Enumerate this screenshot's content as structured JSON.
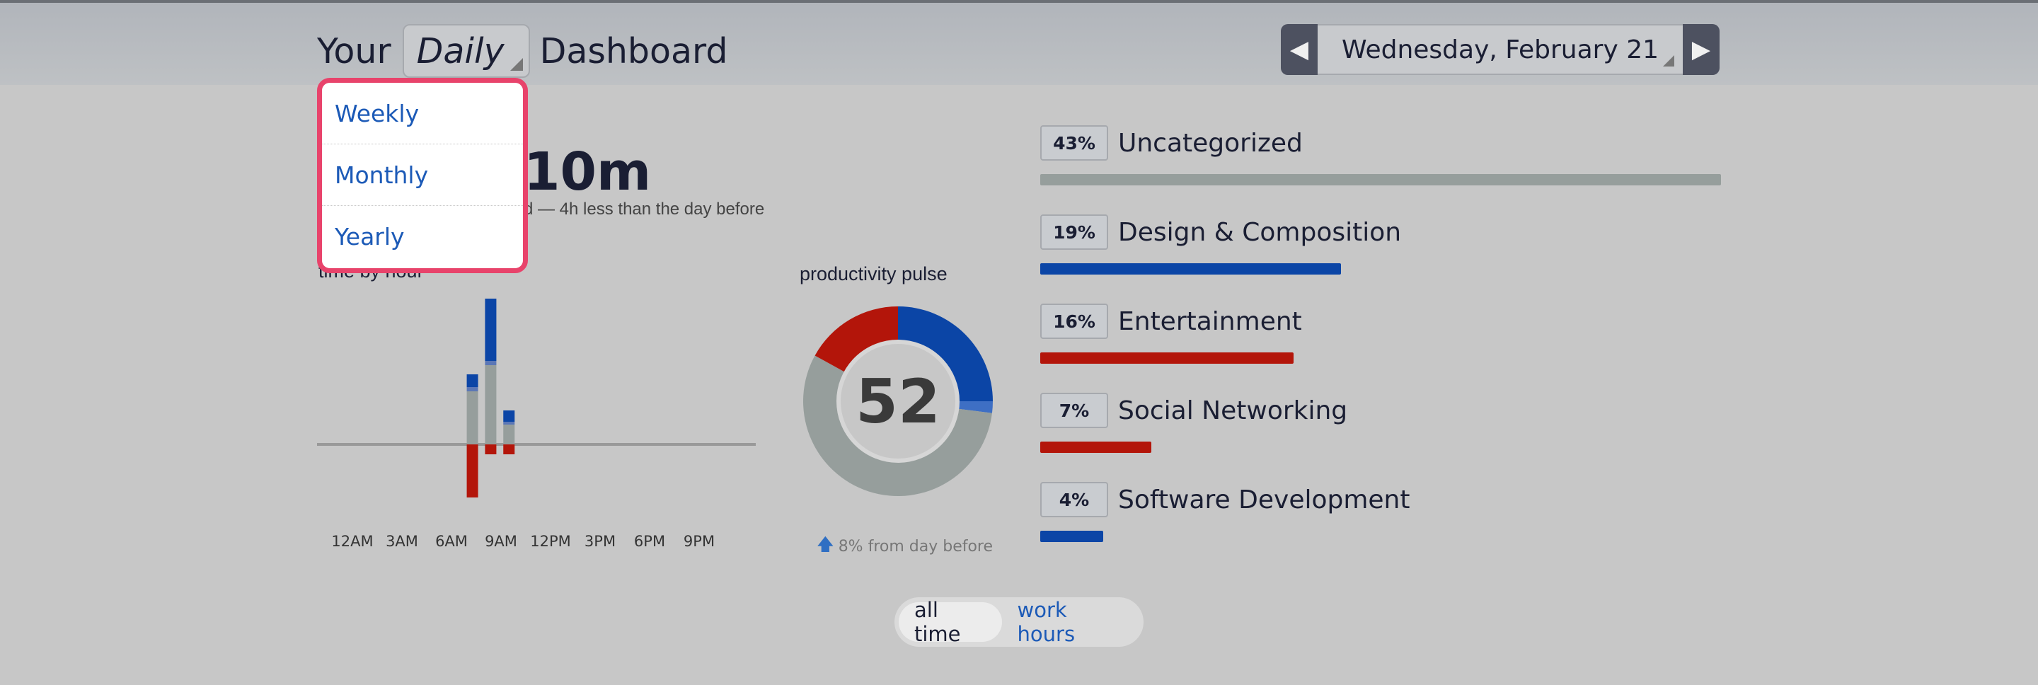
{
  "header": {
    "title_prefix": "Your",
    "range_selected": "Daily",
    "title_suffix": "Dashboard",
    "date": "Wednesday, February 21",
    "prev_icon": "chevron-left-icon",
    "next_icon": "chevron-right-icon"
  },
  "dropdown": {
    "options": [
      "Weekly",
      "Monthly",
      "Yearly"
    ]
  },
  "summary": {
    "total": "10m",
    "comparison": "d — 4h less than the day before"
  },
  "time_by_hour": {
    "label": "time by hour",
    "chart_data": {
      "type": "bar",
      "categories": [
        "12AM",
        "3AM",
        "6AM",
        "9AM",
        "12PM",
        "3PM",
        "6PM",
        "9PM"
      ],
      "tick_labels": [
        "12AM",
        "3AM",
        "6AM",
        "9AM",
        "12PM",
        "3PM",
        "6PM",
        "9PM"
      ],
      "series": [
        {
          "color": "#969e9c",
          "values": []
        },
        {
          "color": "#0b45a6",
          "values": []
        },
        {
          "color": "#b3150a",
          "values": []
        }
      ]
    }
  },
  "pulse": {
    "label": "productivity pulse",
    "score": "52",
    "change": "8% from day before",
    "chart_data": {
      "type": "pie",
      "slices": [
        {
          "value": 25,
          "color": "#0b45a6"
        },
        {
          "value": 2,
          "color": "#3e6fc4"
        },
        {
          "value": 56,
          "color": "#969e9c"
        },
        {
          "value": 17,
          "color": "#b3150a"
        }
      ]
    }
  },
  "categories": [
    {
      "pct": "43%",
      "name": "Uncategorized",
      "value": 43,
      "color": "#969e9c"
    },
    {
      "pct": "19%",
      "name": "Design & Composition",
      "value": 19,
      "color": "#0b45a6"
    },
    {
      "pct": "16%",
      "name": "Entertainment",
      "value": 16,
      "color": "#b3150a"
    },
    {
      "pct": "7%",
      "name": "Social Networking",
      "value": 7,
      "color": "#b3150a"
    },
    {
      "pct": "4%",
      "name": "Software Development",
      "value": 4,
      "color": "#0b45a6"
    }
  ],
  "toggle": {
    "options": [
      "all time",
      "work hours"
    ],
    "active": "all time"
  }
}
